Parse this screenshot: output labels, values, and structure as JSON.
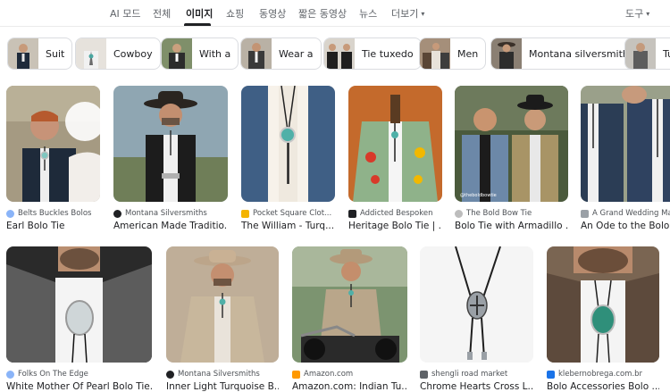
{
  "tabs": [
    {
      "label": "AI 모드"
    },
    {
      "label": "전체"
    },
    {
      "label": "이미지"
    },
    {
      "label": "쇼핑"
    },
    {
      "label": "동영상"
    },
    {
      "label": "짧은 동영상"
    },
    {
      "label": "뉴스"
    },
    {
      "label": "더보기"
    }
  ],
  "tools_label": "도구",
  "chips": [
    {
      "label": "Suit"
    },
    {
      "label": "Cowboy"
    },
    {
      "label": "With a"
    },
    {
      "label": "Wear a"
    },
    {
      "label": "Tie tuxedo"
    },
    {
      "label": "Men"
    },
    {
      "label": "Montana silversmith"
    },
    {
      "label": "Tu"
    }
  ],
  "results": [
    {
      "source": "Belts Buckles Bolos",
      "title": "Earl Bolo Tie",
      "source_icon_color": "#8ab4f8"
    },
    {
      "source": "Montana Silversmiths",
      "title": "American Made Traditio...",
      "source_icon_color": "#202124"
    },
    {
      "source": "Pocket Square Clot...",
      "title": "The William - Turq...",
      "source_icon_color": "#f4b400"
    },
    {
      "source": "Addicted Bespoken",
      "title": "Heritage Bolo Tie | ...",
      "source_icon_color": "#202124"
    },
    {
      "source": "The Bold Bow Tie",
      "title": "Bolo Tie with Armadillo ...",
      "source_icon_color": "#bdbdbd"
    },
    {
      "source": "A Grand Wedding Ma",
      "title": "An Ode to the Bolo Ti",
      "source_icon_color": "#9aa0a6"
    },
    {
      "source": "Folks On The Edge",
      "title": "White Mother Of Pearl Bolo Tie...",
      "source_icon_color": "#8ab4f8"
    },
    {
      "source": "Montana Silversmiths",
      "title": "Inner Light Turquoise B...",
      "source_icon_color": "#202124"
    },
    {
      "source": "Amazon.com",
      "title": "Amazon.com: Indian Tu...",
      "source_icon_color": "#ff9900"
    },
    {
      "source": "shengli road market",
      "title": "Chrome Hearts Cross L...",
      "source_icon_color": "#5f6368"
    },
    {
      "source": "klebernobrega.com.br",
      "title": "Bolo Accessories Bolo ...",
      "source_icon_color": "#1a73e8"
    }
  ]
}
